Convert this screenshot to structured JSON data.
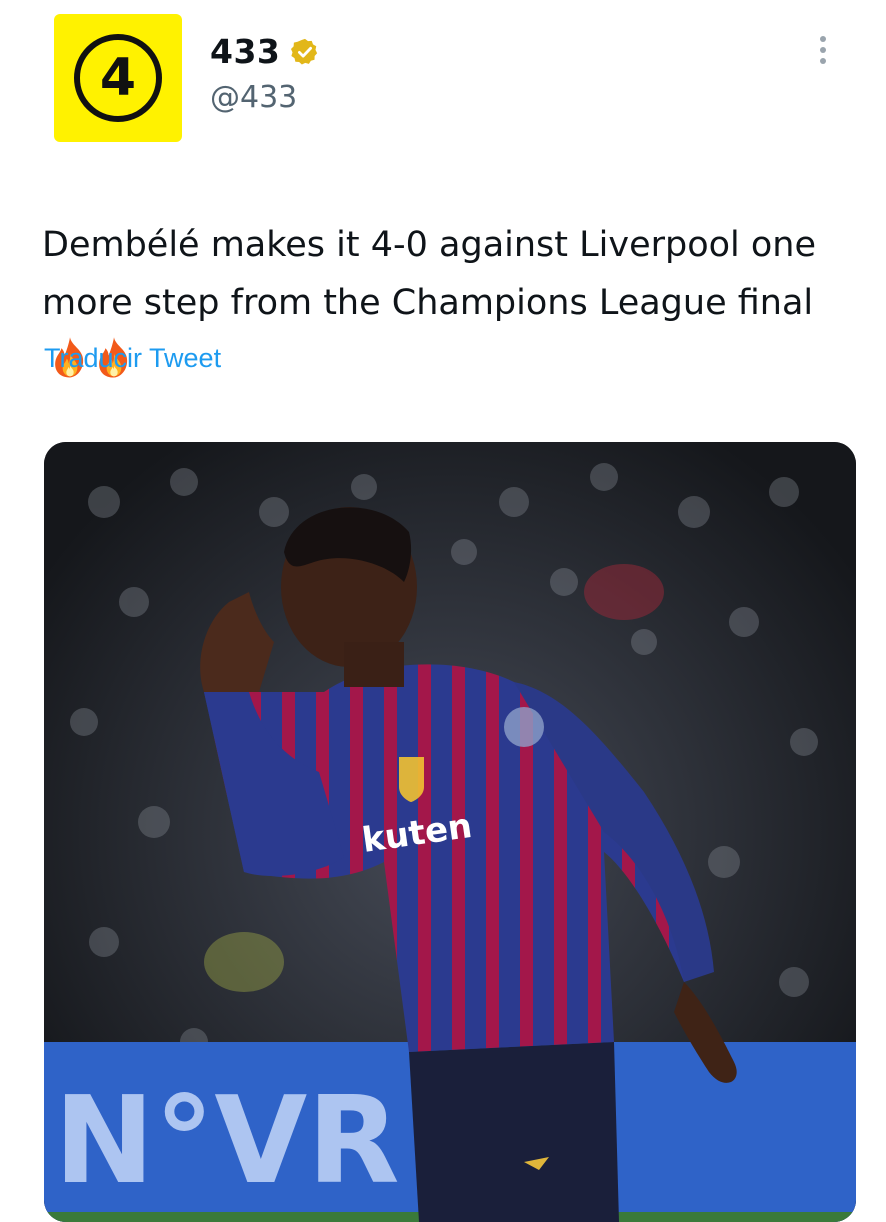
{
  "account": {
    "avatar_text": "4",
    "display_name": "433",
    "handle": "@433",
    "verified": true,
    "avatar_color": "#fff200"
  },
  "tweet": {
    "text": "Dembélé makes it 4-0 against Liverpool one more step from the Champions League final",
    "emoji": [
      "fire-emoji",
      "fire-emoji"
    ],
    "translate_label": "Traducir Tweet"
  },
  "media": {
    "sponsor_text": "kuten",
    "board_text": "N°VR"
  },
  "colors": {
    "link": "#1d9bf0",
    "shirt_blue": "#2b3a8f",
    "shirt_red": "#a3174a",
    "board": "#2f63c8"
  }
}
